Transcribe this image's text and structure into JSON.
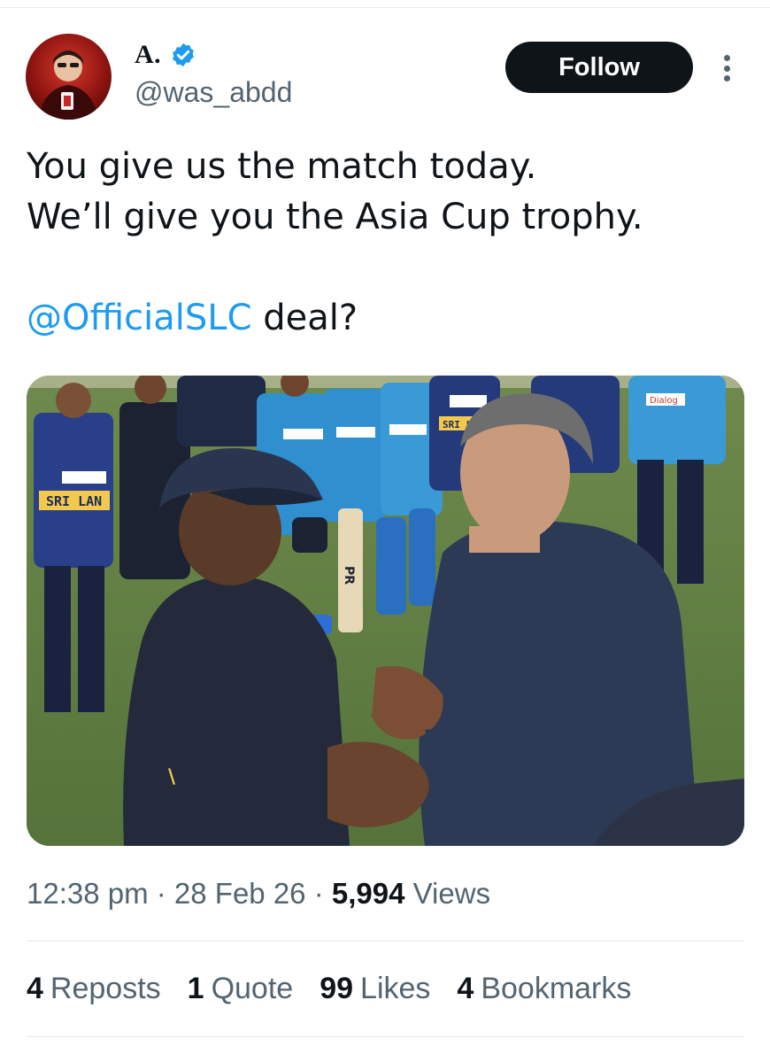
{
  "author": {
    "display_name": "A.",
    "handle": "@was_abdd",
    "verified": true,
    "avatar_icon": "avatar-image"
  },
  "actions": {
    "follow_label": "Follow",
    "more_icon": "more-vertical-icon"
  },
  "tweet": {
    "line1": "You give us the match today.",
    "line2": "We’ll give you the Asia Cup trophy.",
    "mention": "@OfficialSLC",
    "line3_rest": " deal?"
  },
  "media": {
    "photo_text": {
      "jersey_left": "SRI LAN",
      "jersey_center": "SRI LA",
      "sponsor": "Dialog",
      "bat_label": "PR"
    }
  },
  "meta": {
    "time": "12:38 pm",
    "sep1": " · ",
    "date": "28 Feb 26",
    "sep2": " · ",
    "views_count": "5,994",
    "views_label": " Views"
  },
  "stats": [
    {
      "count": "4",
      "label": "Reposts"
    },
    {
      "count": "1",
      "label": "Quote"
    },
    {
      "count": "99",
      "label": "Likes"
    },
    {
      "count": "4",
      "label": "Bookmarks"
    }
  ],
  "colors": {
    "accent": "#1d9bf0",
    "text": "#0f1419",
    "muted": "#536471",
    "button_bg": "#0f1419"
  }
}
